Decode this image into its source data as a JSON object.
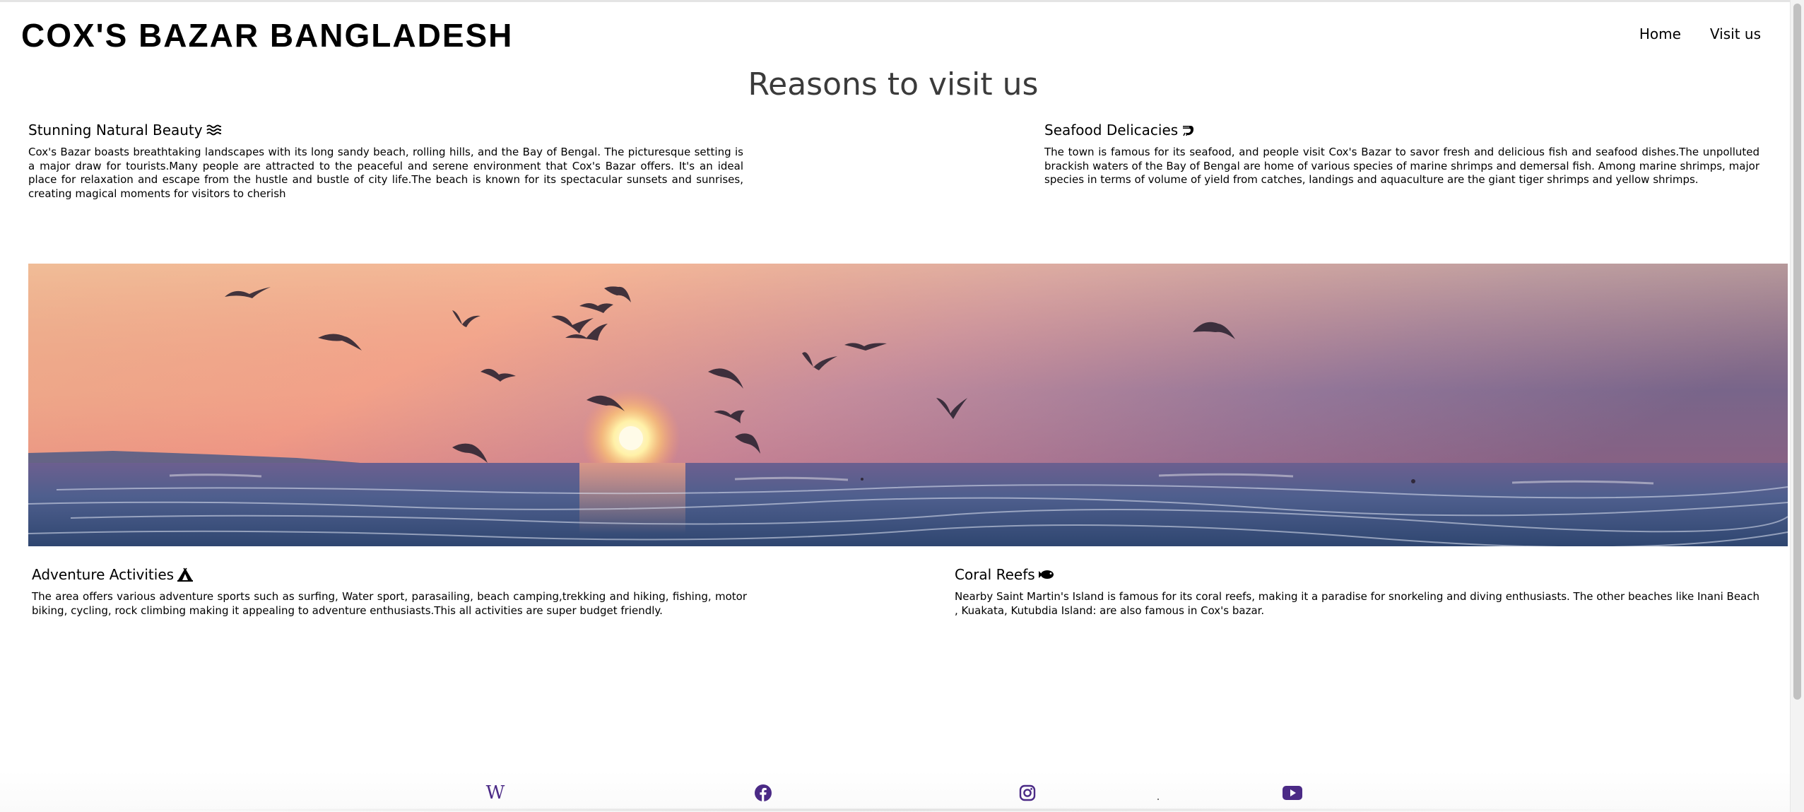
{
  "header": {
    "site_title": "COX'S BAZAR BANGLADESH",
    "nav": [
      "Home",
      "Visit us"
    ]
  },
  "main": {
    "heading": "Reasons to visit us",
    "reasons": [
      {
        "title": "Stunning Natural Beauty",
        "icon": "waves-icon",
        "text": "Cox's Bazar boasts breathtaking landscapes with its long sandy beach, rolling hills, and the Bay of Bengal. The picturesque setting is a major draw for tourists.Many people are attracted to the peaceful and serene environment that Cox's Bazar offers. It's an ideal place for relaxation and escape from the hustle and bustle of city life.The beach is known for its spectacular sunsets and sunrises, creating magical moments for visitors to cherish"
      },
      {
        "title": "Seafood Delicacies",
        "icon": "shrimp-icon",
        "text": "The town is famous for its seafood, and people visit Cox's Bazar to savor fresh and delicious fish and seafood dishes.The unpolluted brackish waters of the Bay of Bengal are home of various species of marine shrimps and demersal fish. Among marine shrimps, major species in terms of volume of yield from catches, landings and aquaculture are the giant tiger shrimps and yellow shrimps."
      },
      {
        "title": "Adventure Activities",
        "icon": "tent-icon",
        "text": "The area offers various adventure sports such as surfing, Water sport, parasailing, beach camping,trekking and hiking, fishing, motor biking, cycling, rock climbing making it appealing to adventure enthusiasts.This all activities are super budget friendly."
      },
      {
        "title": "Coral Reefs",
        "icon": "fish-icon",
        "text": "Nearby Saint Martin's Island is famous for its coral reefs, making it a paradise for snorkeling and diving enthusiasts. The other beaches like Inani Beach , Kuakata, Kutubdia Island: are also famous in Cox's bazar."
      }
    ],
    "banner_icon": "sunset-birds-photo"
  },
  "footer": {
    "social": [
      "wikipedia-icon",
      "facebook-icon",
      "instagram-icon",
      "youtube-icon"
    ],
    "wiki_glyph": "W",
    "icon_color": "#4b2a86"
  }
}
